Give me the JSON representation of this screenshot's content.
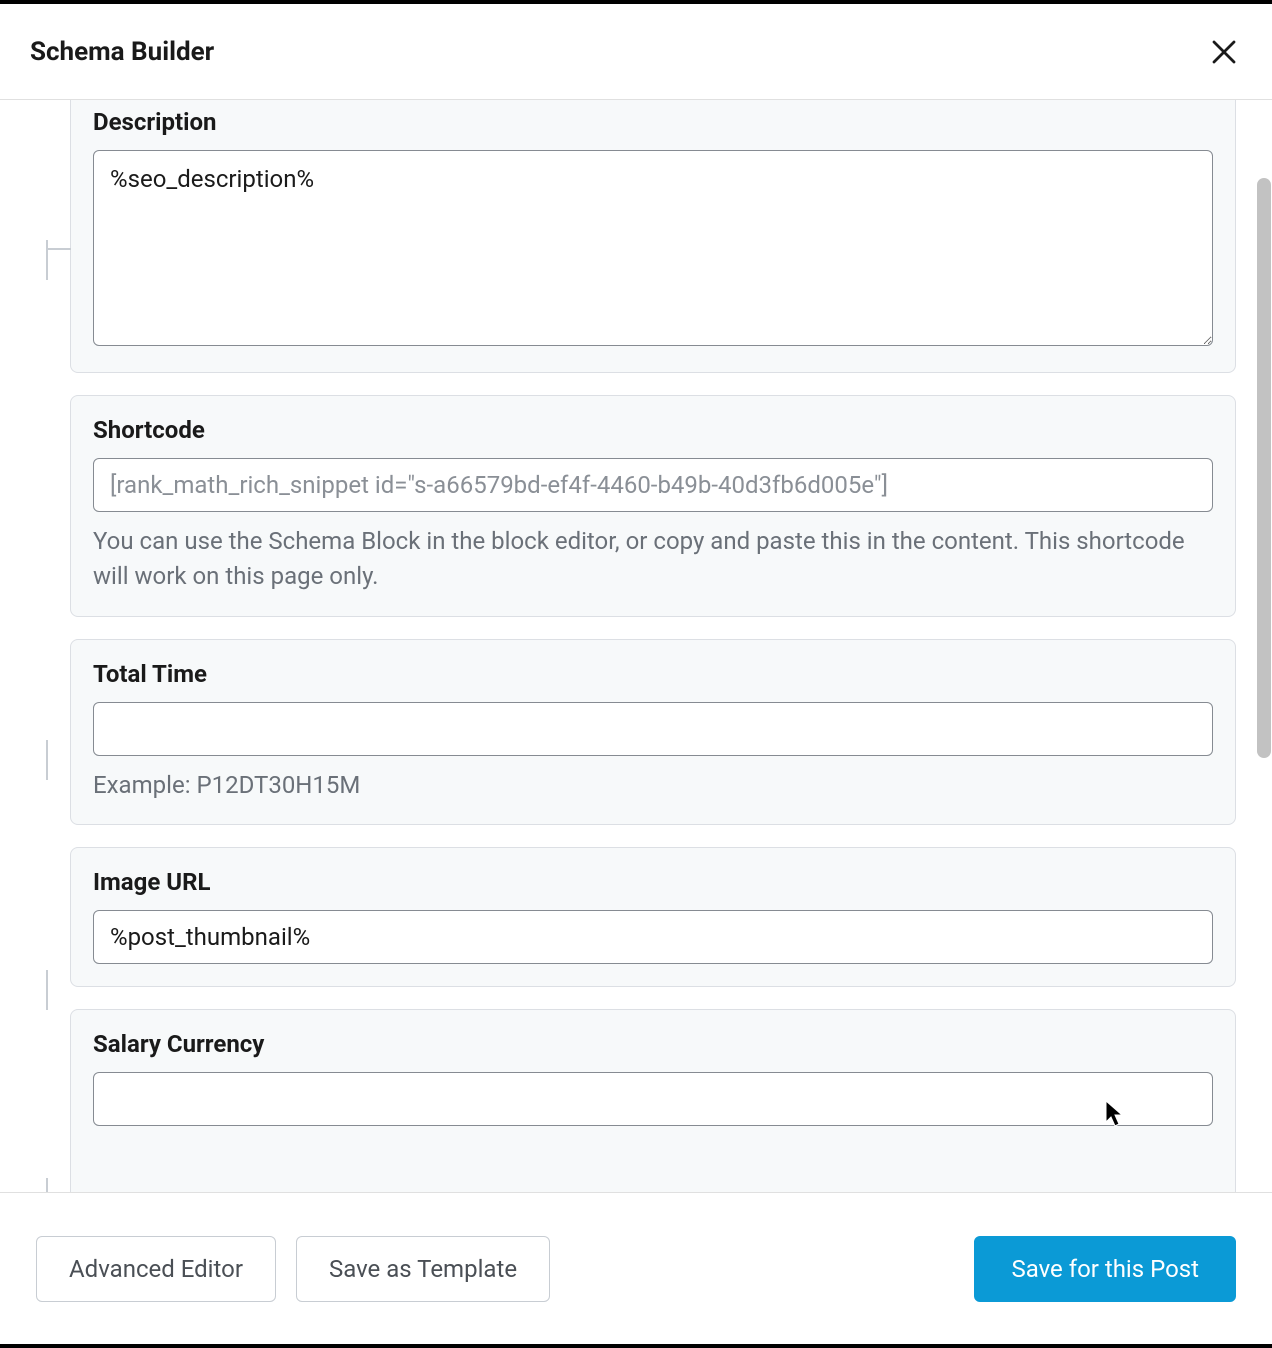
{
  "header": {
    "title": "Schema Builder"
  },
  "fields": {
    "description": {
      "label": "Description",
      "value": "%seo_description%"
    },
    "shortcode": {
      "label": "Shortcode",
      "value": "[rank_math_rich_snippet id=\"s-a66579bd-ef4f-4460-b49b-40d3fb6d005e\"]",
      "help": "You can use the Schema Block in the block editor, or copy and paste this in the content. This shortcode will work on this page only."
    },
    "total_time": {
      "label": "Total Time",
      "value": "",
      "help": "Example: P12DT30H15M"
    },
    "image_url": {
      "label": "Image URL",
      "value": "%post_thumbnail%"
    },
    "salary_currency": {
      "label": "Salary Currency",
      "value": ""
    }
  },
  "footer": {
    "advanced_editor": "Advanced Editor",
    "save_template": "Save as Template",
    "save_post": "Save for this Post"
  }
}
